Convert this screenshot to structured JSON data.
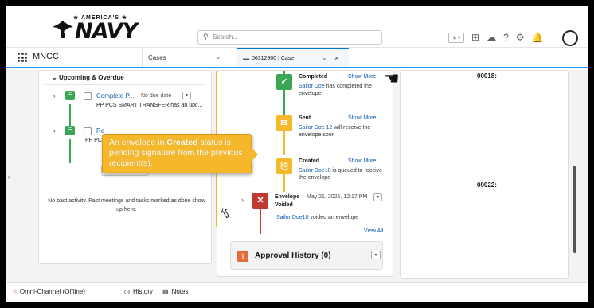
{
  "header": {
    "logo_small": "★ AMERICA'S ★",
    "logo_word": "NAVY",
    "search_placeholder": "Search...",
    "icons": [
      "favorites-icon",
      "add-icon",
      "setup-assistant-icon",
      "help-icon",
      "settings-icon",
      "notifications-icon"
    ]
  },
  "nav": {
    "app_name": "MNCC",
    "tab_label": "Cases",
    "subtab_label": "06312900 | Case"
  },
  "left_panel": {
    "section_title": "Upcoming & Overdue",
    "tasks": [
      {
        "title": "Complete P...",
        "due": "No due date",
        "desc": "PP PCS SMART TRANSFER has an upc..."
      },
      {
        "title": "Re",
        "due": "",
        "desc": "PP PC"
      }
    ],
    "no_past_text": "No past activity. Past meetings and tasks marked as done show up here."
  },
  "envelope_timeline": {
    "items": [
      {
        "status": "Completed",
        "show_more": "Show More",
        "actor": "Sailor Doe",
        "text": " has completed the envelope",
        "color": "#3ba755"
      },
      {
        "status": "Sent",
        "show_more": "Show More",
        "actor": "Sailor Doe 12",
        "text": " will receive the envelope soon",
        "color": "#f6b82b"
      },
      {
        "status": "Created",
        "show_more": "Show More",
        "actor": "Sailor Doe10",
        "text": " is queued to receive the envelope",
        "color": "#f6b82b"
      },
      {
        "status": "Envelope Voided",
        "date": "May 21, 2025, 12:17 PM",
        "actor": "Sailor Doe10",
        "text": " voided an envelope",
        "color": "#c23934"
      }
    ],
    "view_all": "View All",
    "approval_history": "Approval History (0)"
  },
  "right_panel": {
    "label_top": "00018:",
    "label_mid": "00022:"
  },
  "tooltip": {
    "pre": "An envelope in ",
    "bold": "Created",
    "post": " status is pending signature from the previous recipient(s)."
  },
  "footer": {
    "omni": "Omni-Channel (Offline)",
    "history": "History",
    "notes": "Notes"
  }
}
